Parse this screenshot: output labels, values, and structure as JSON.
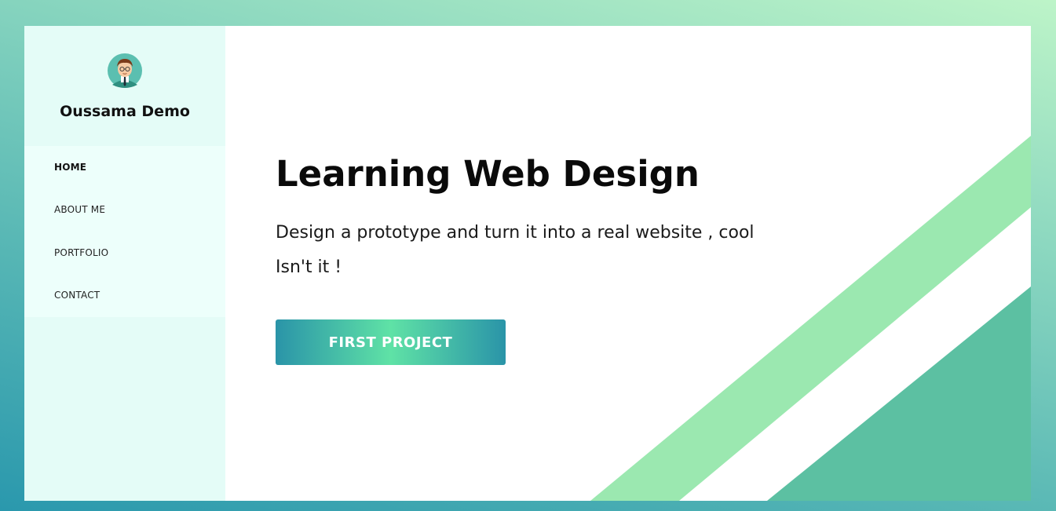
{
  "sidebar": {
    "profile_name": "Oussama Demo",
    "avatar_icon": "avatar-icon",
    "nav": [
      {
        "label": "HOME",
        "active": true
      },
      {
        "label": "ABOUT ME",
        "active": false
      },
      {
        "label": "PORTFOLIO",
        "active": false
      },
      {
        "label": "CONTACT",
        "active": false
      }
    ]
  },
  "hero": {
    "title": "Learning Web Design",
    "text": "Design a prototype and turn it into a real website , cool Isn't it !",
    "cta_label": "FIRST PROJECT"
  },
  "colors": {
    "sidebar_bg": "#e4fcf7",
    "stripe_light": "#9be8b0",
    "stripe_dark": "#5cc0a2",
    "accent_start": "#2a94a8",
    "accent_mid": "#5fe2a6"
  }
}
